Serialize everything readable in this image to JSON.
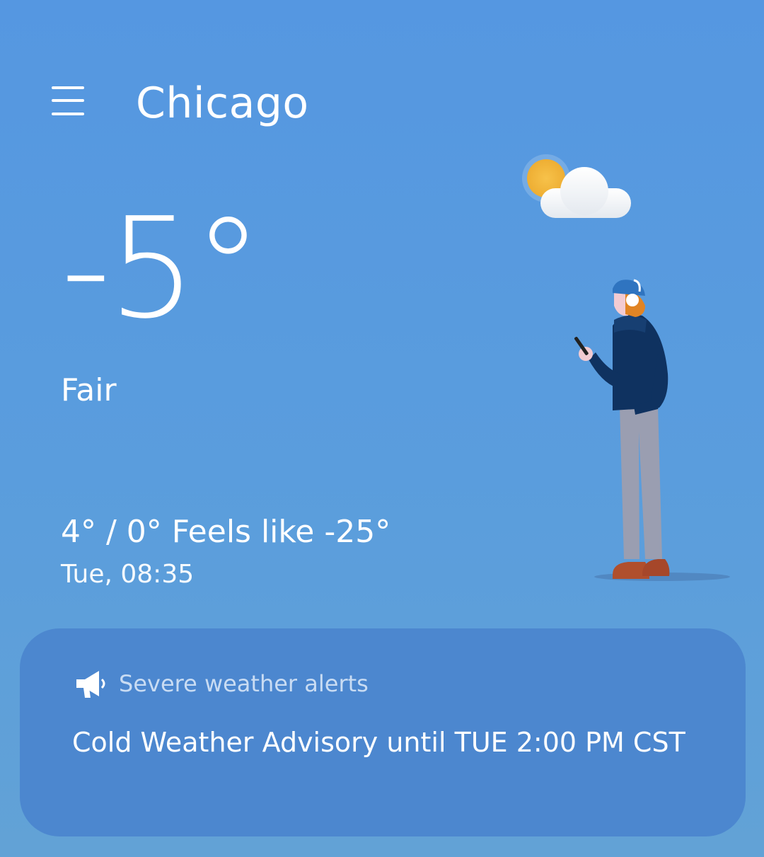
{
  "header": {
    "menu_icon": "hamburger-menu-icon",
    "city": "Chicago"
  },
  "current": {
    "temperature": "-5°",
    "condition": "Fair",
    "condition_icon": "partly-sunny-icon",
    "high_low_feels": "4° / 0° Feels like -25°",
    "updated": "Tue, 08:35"
  },
  "alert": {
    "icon": "megaphone-icon",
    "label": "Severe weather alerts",
    "text": "Cold Weather Advisory until TUE 2:00 PM CST"
  },
  "colors": {
    "background": "#5597e1",
    "alert_card": "#4c87cf",
    "alert_label": "#c9dcf3",
    "sun": "#f3b73e"
  }
}
